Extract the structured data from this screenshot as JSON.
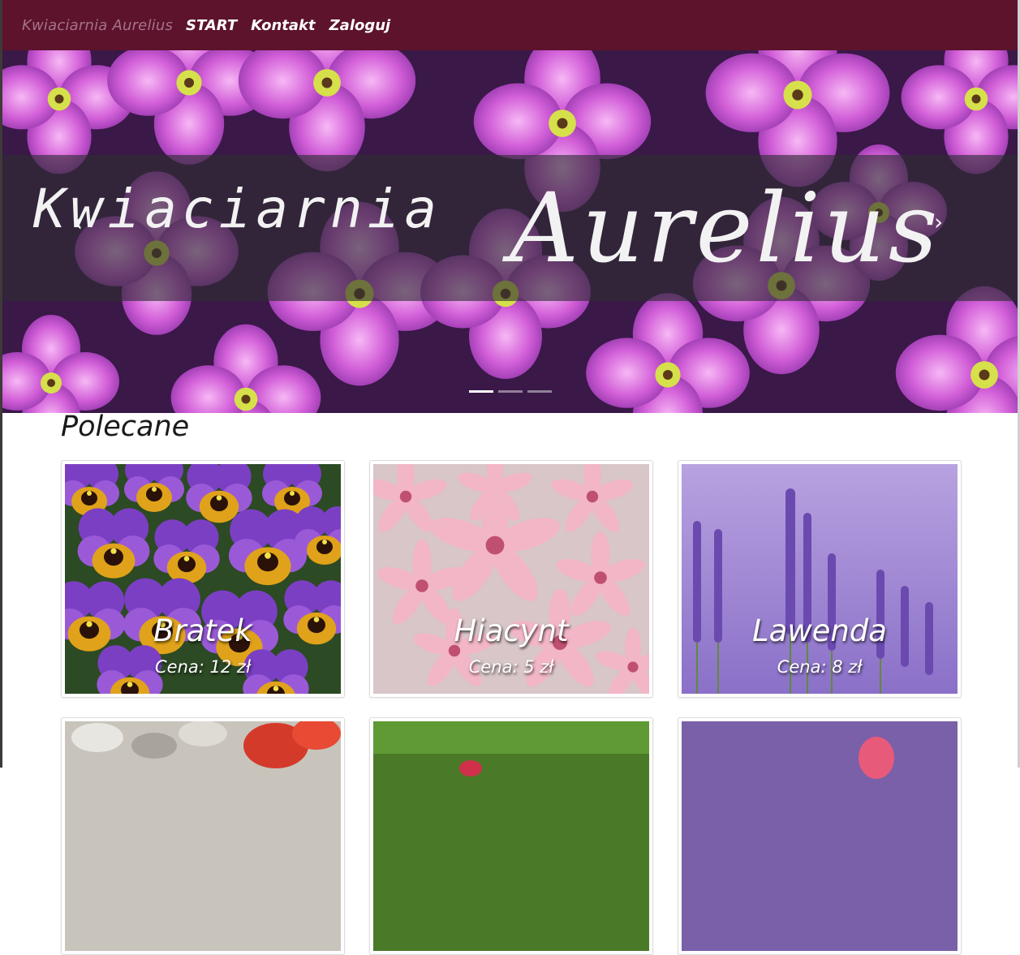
{
  "navbar": {
    "brand": "Kwiaciarnia Aurelius",
    "links": [
      {
        "label": "START"
      },
      {
        "label": "Kontakt"
      },
      {
        "label": "Zaloguj"
      }
    ]
  },
  "carousel": {
    "title_left": "Kwiaciarnia",
    "title_right": "Aurelius",
    "prev_icon": "‹",
    "next_icon": "›",
    "slides": 3,
    "active_slide": 1
  },
  "recommended": {
    "title": "Polecane",
    "products": [
      {
        "name": "Bratek",
        "price": "Cena: 12 zł"
      },
      {
        "name": "Hiacynt",
        "price": "Cena: 5 zł"
      },
      {
        "name": "Lawenda",
        "price": "Cena: 8 zł"
      }
    ]
  },
  "colors": {
    "navbar_bg": "#5c132b",
    "brand_text": "#a6728a",
    "banner_overlay": "rgba(45,45,50,0.62)"
  }
}
